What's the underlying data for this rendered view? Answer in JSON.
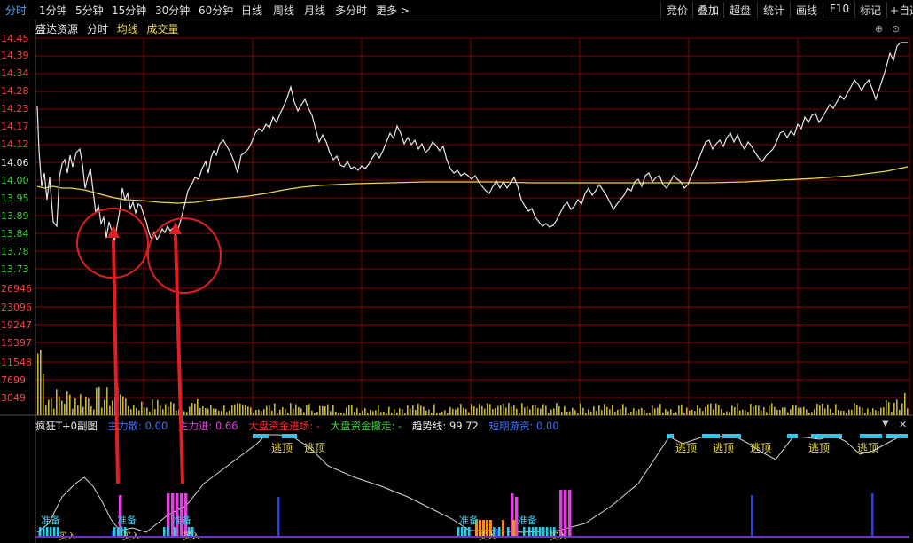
{
  "toolbar": {
    "tabs": [
      "分时",
      "1分钟",
      "5分钟",
      "15分钟",
      "30分钟",
      "60分钟",
      "日线",
      "周线",
      "月线",
      "多分时",
      "更多 >"
    ],
    "right_tools": [
      "竞价",
      "叠加",
      "超盘",
      "统计",
      "画线",
      "F10",
      "标记",
      "+自选"
    ]
  },
  "info": {
    "stock_name": "盛达资源",
    "mode": "分时",
    "avg_label": "均线",
    "volume_label": "成交量"
  },
  "price_axis": [
    "14.45",
    "14.39",
    "14.34",
    "14.28",
    "14.23",
    "14.17",
    "14.12",
    "14.06",
    "14.00",
    "13.95",
    "13.89",
    "13.84",
    "13.78",
    "13.73"
  ],
  "volume_axis": [
    "26946",
    "23096",
    "19247",
    "15397",
    "11548",
    "7699",
    "3849"
  ],
  "indicator": {
    "title": "疯狂T+0副图",
    "items": [
      {
        "label": "主力散: 0.00",
        "color": "#4070ff"
      },
      {
        "label": "主力进: 0.66",
        "color": "#e040e0"
      },
      {
        "label": "大盘资金进场: -",
        "color": "#ff3030"
      },
      {
        "label": "大盘资金撤走: -",
        "color": "#3fd13f"
      },
      {
        "label": "趋势线: 99.72",
        "color": "#e8e8e8"
      },
      {
        "label": "短期游资: 0.00",
        "color": "#4070ff"
      }
    ],
    "escape_label": "逃顶",
    "ready_label": "准备",
    "buy_label": "买入"
  },
  "colors": {
    "grid": "#8b0000",
    "price_line": "#e8e8e8",
    "avg_line": "#e8d84a",
    "volume": "#c8b830",
    "annotation": "#e02020"
  }
}
